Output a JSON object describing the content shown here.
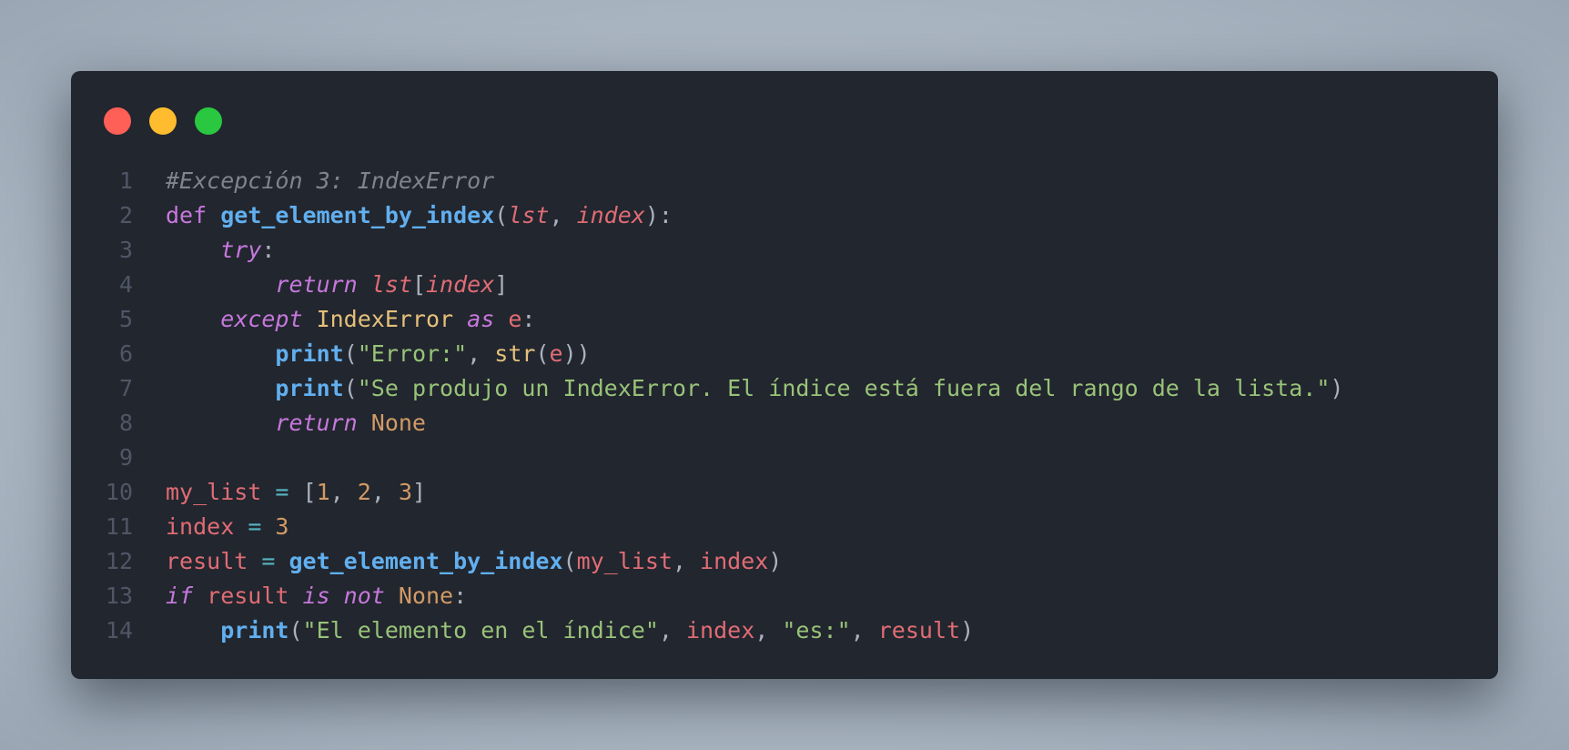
{
  "window": {
    "controls": [
      "close",
      "minimize",
      "maximize"
    ]
  },
  "code": {
    "lines": [
      {
        "n": "1",
        "tokens": [
          {
            "t": "cm",
            "v": "#Excepción 3: IndexError"
          }
        ]
      },
      {
        "n": "2",
        "tokens": [
          {
            "t": "kw",
            "v": "def "
          },
          {
            "t": "fn",
            "v": "get_element_by_index"
          },
          {
            "t": "pn",
            "v": "("
          },
          {
            "t": "pr",
            "v": "lst"
          },
          {
            "t": "pn",
            "v": ", "
          },
          {
            "t": "pr",
            "v": "index"
          },
          {
            "t": "pn",
            "v": "):"
          }
        ]
      },
      {
        "n": "3",
        "tokens": [
          {
            "t": "pn",
            "v": "    "
          },
          {
            "t": "kwi",
            "v": "try"
          },
          {
            "t": "pn",
            "v": ":"
          }
        ]
      },
      {
        "n": "4",
        "tokens": [
          {
            "t": "pn",
            "v": "        "
          },
          {
            "t": "kwi",
            "v": "return "
          },
          {
            "t": "pr",
            "v": "lst"
          },
          {
            "t": "pn",
            "v": "["
          },
          {
            "t": "pr",
            "v": "index"
          },
          {
            "t": "pn",
            "v": "]"
          }
        ]
      },
      {
        "n": "5",
        "tokens": [
          {
            "t": "pn",
            "v": "    "
          },
          {
            "t": "kwi",
            "v": "except "
          },
          {
            "t": "cls",
            "v": "IndexError "
          },
          {
            "t": "kwi",
            "v": "as "
          },
          {
            "t": "var",
            "v": "e"
          },
          {
            "t": "pn",
            "v": ":"
          }
        ]
      },
      {
        "n": "6",
        "tokens": [
          {
            "t": "pn",
            "v": "        "
          },
          {
            "t": "fn",
            "v": "print"
          },
          {
            "t": "pn",
            "v": "("
          },
          {
            "t": "str",
            "v": "\"Error:\""
          },
          {
            "t": "pn",
            "v": ", "
          },
          {
            "t": "bi",
            "v": "str"
          },
          {
            "t": "pn",
            "v": "("
          },
          {
            "t": "var",
            "v": "e"
          },
          {
            "t": "pn",
            "v": "))"
          }
        ]
      },
      {
        "n": "7",
        "tokens": [
          {
            "t": "pn",
            "v": "        "
          },
          {
            "t": "fn",
            "v": "print"
          },
          {
            "t": "pn",
            "v": "("
          },
          {
            "t": "str",
            "v": "\"Se produjo un IndexError. El índice está fuera del rango de la lista.\""
          },
          {
            "t": "pn",
            "v": ")"
          }
        ]
      },
      {
        "n": "8",
        "tokens": [
          {
            "t": "pn",
            "v": "        "
          },
          {
            "t": "kwi",
            "v": "return "
          },
          {
            "t": "cnst",
            "v": "None"
          }
        ]
      },
      {
        "n": "9",
        "tokens": []
      },
      {
        "n": "10",
        "tokens": [
          {
            "t": "var",
            "v": "my_list "
          },
          {
            "t": "op",
            "v": "= "
          },
          {
            "t": "pn",
            "v": "["
          },
          {
            "t": "num",
            "v": "1"
          },
          {
            "t": "pn",
            "v": ", "
          },
          {
            "t": "num",
            "v": "2"
          },
          {
            "t": "pn",
            "v": ", "
          },
          {
            "t": "num",
            "v": "3"
          },
          {
            "t": "pn",
            "v": "]"
          }
        ]
      },
      {
        "n": "11",
        "tokens": [
          {
            "t": "var",
            "v": "index "
          },
          {
            "t": "op",
            "v": "= "
          },
          {
            "t": "num",
            "v": "3"
          }
        ]
      },
      {
        "n": "12",
        "tokens": [
          {
            "t": "var",
            "v": "result "
          },
          {
            "t": "op",
            "v": "= "
          },
          {
            "t": "fn",
            "v": "get_element_by_index"
          },
          {
            "t": "pn",
            "v": "("
          },
          {
            "t": "var",
            "v": "my_list"
          },
          {
            "t": "pn",
            "v": ", "
          },
          {
            "t": "var",
            "v": "index"
          },
          {
            "t": "pn",
            "v": ")"
          }
        ]
      },
      {
        "n": "13",
        "tokens": [
          {
            "t": "kwi",
            "v": "if "
          },
          {
            "t": "var",
            "v": "result "
          },
          {
            "t": "kwi",
            "v": "is not "
          },
          {
            "t": "cnst",
            "v": "None"
          },
          {
            "t": "pn",
            "v": ":"
          }
        ]
      },
      {
        "n": "14",
        "tokens": [
          {
            "t": "pn",
            "v": "    "
          },
          {
            "t": "fn",
            "v": "print"
          },
          {
            "t": "pn",
            "v": "("
          },
          {
            "t": "str",
            "v": "\"El elemento en el índice\""
          },
          {
            "t": "pn",
            "v": ", "
          },
          {
            "t": "var",
            "v": "index"
          },
          {
            "t": "pn",
            "v": ", "
          },
          {
            "t": "str",
            "v": "\"es:\""
          },
          {
            "t": "pn",
            "v": ", "
          },
          {
            "t": "var",
            "v": "result"
          },
          {
            "t": "pn",
            "v": ")"
          }
        ]
      }
    ]
  }
}
